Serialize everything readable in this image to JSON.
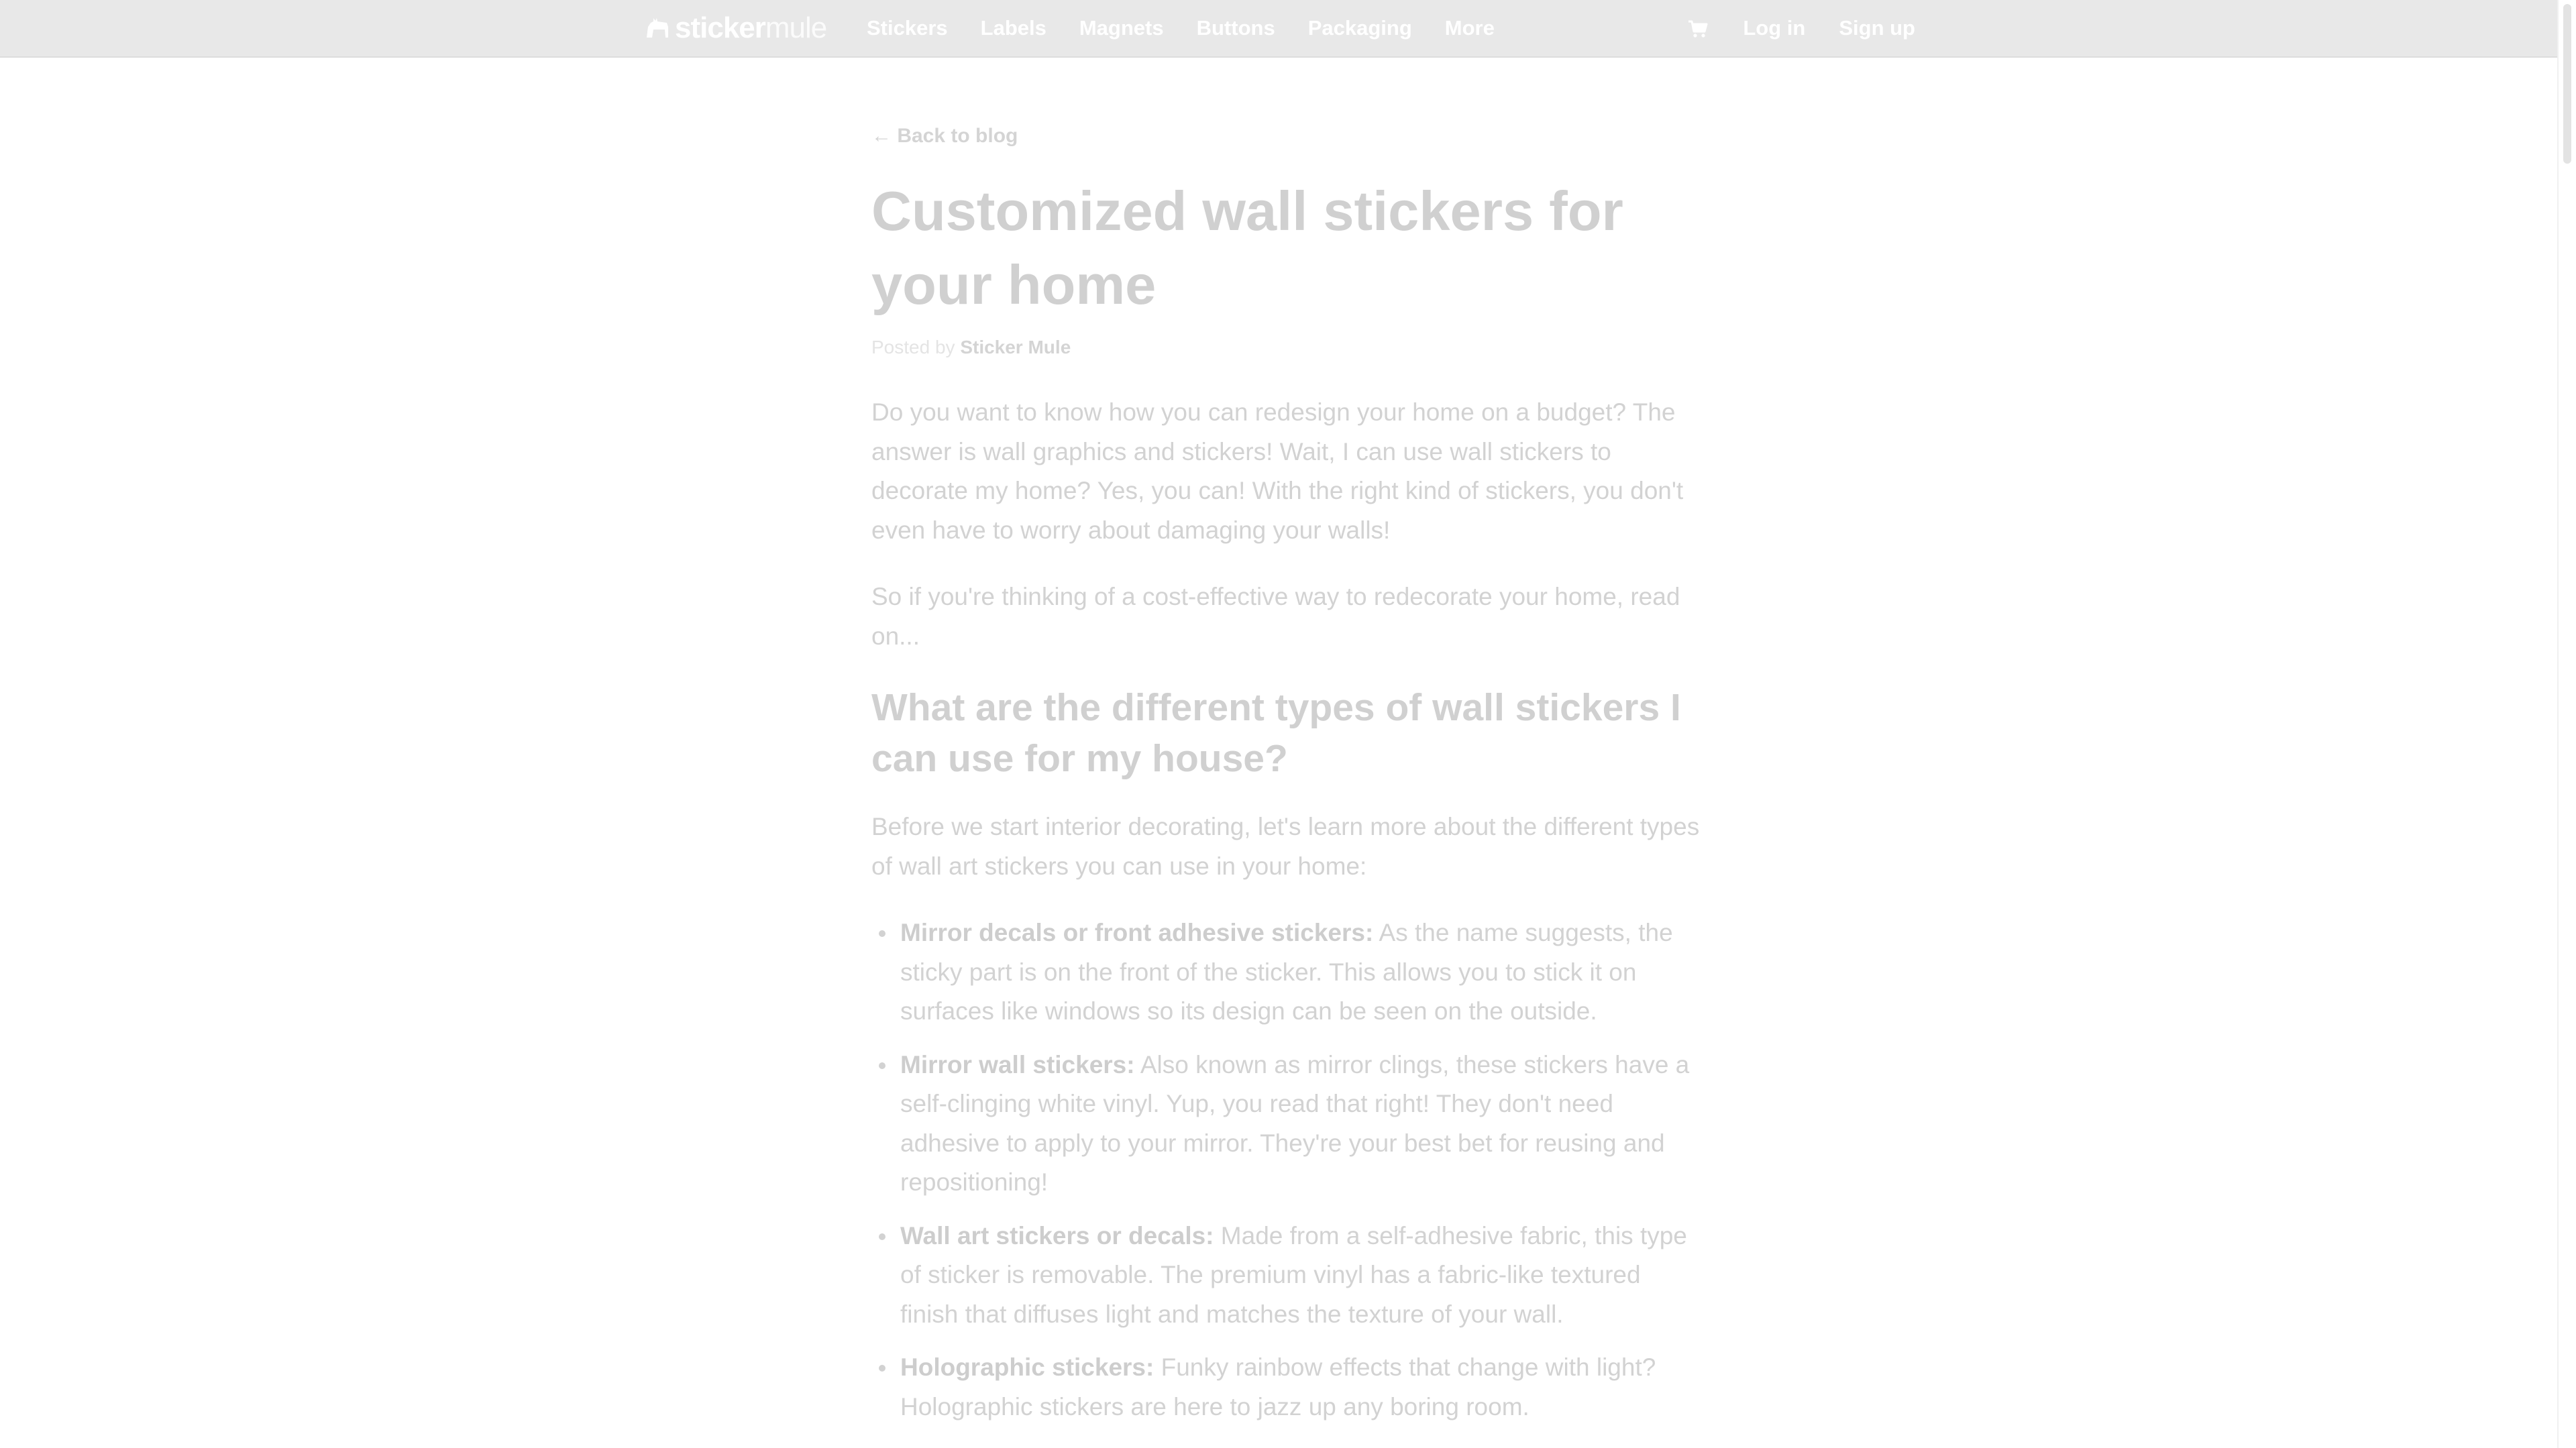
{
  "header": {
    "logo_bold": "sticker",
    "logo_light": "mule",
    "nav": [
      "Stickers",
      "Labels",
      "Magnets",
      "Buttons",
      "Packaging",
      "More"
    ],
    "cart_icon": "cart-icon",
    "login": "Log in",
    "signup": "Sign up"
  },
  "article": {
    "back_link": "← Back to blog",
    "title": "Customized wall stickers for your home",
    "byline_prefix": "Posted by",
    "author": "Sticker Mule",
    "intro_1": "Do you want to know how you can redesign your home on a budget? The answer is wall graphics and stickers! Wait, I can use wall stickers to decorate my home? Yes, you can! With the right kind of stickers, you don't even have to worry about damaging your walls!",
    "intro_2": "So if you're thinking of a cost-effective way to redecorate your home, read on...",
    "heading_1": "What are the different types of wall stickers I can use for my house?",
    "section_intro": "Before we start interior decorating, let's learn more about the different types of wall art stickers you can use in your home:",
    "types": [
      {
        "term": "Mirror decals or front adhesive stickers:",
        "text": " As the name suggests, the sticky part is on the front of the sticker. This allows you to stick it on surfaces like windows so its design can be seen on the outside."
      },
      {
        "term": "Mirror wall stickers:",
        "text": " Also known as mirror clings, these stickers have a self-clinging white vinyl. Yup, you read that right! They don't need adhesive to apply to your mirror. They're your best bet for reusing and repositioning!"
      },
      {
        "term": "Wall art stickers or decals:",
        "text": " Made from a self-adhesive fabric, this type of sticker is removable. The premium vinyl has a fabric-like textured finish that diffuses light and matches the texture of your wall."
      },
      {
        "term": "Holographic stickers:",
        "text": " Funky rainbow effects that change with light? Holographic stickers are here to jazz up any boring room."
      }
    ]
  },
  "colors": {
    "topbar": "#e8e8e8",
    "nav_text": "#ffffff",
    "body_text": "#d2d2d2"
  }
}
